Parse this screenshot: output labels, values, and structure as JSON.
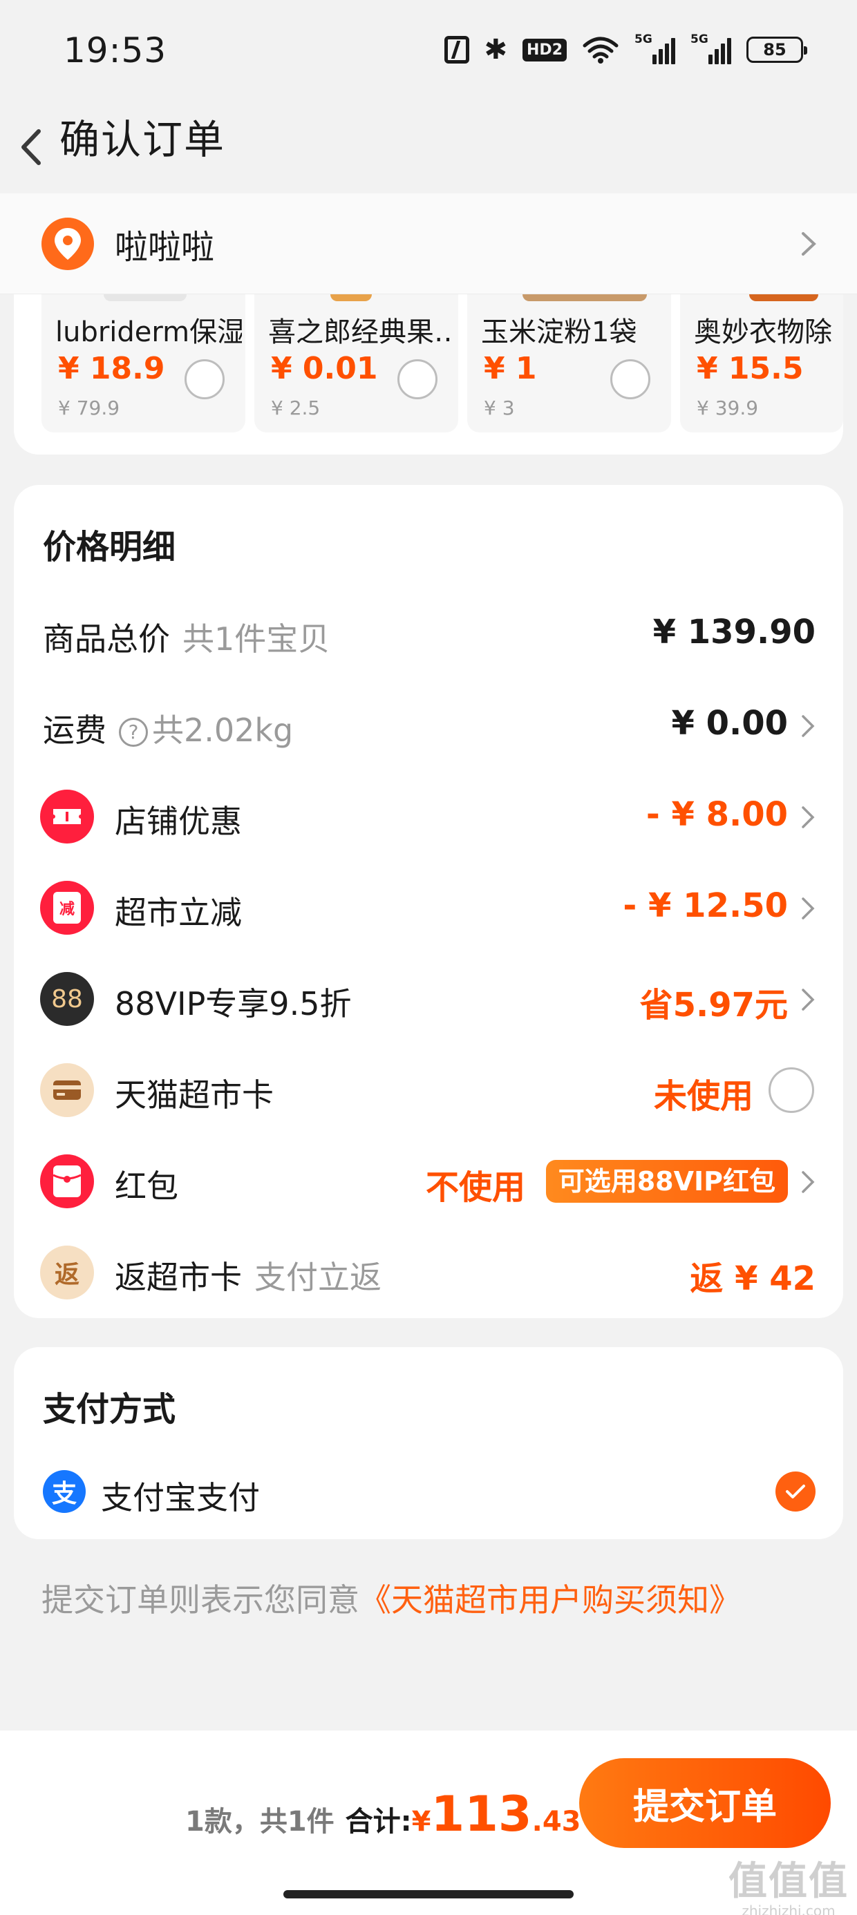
{
  "status_bar": {
    "time": "19:53",
    "hd_label": "HD2",
    "sig1_label": "5G",
    "sig2_label": "5G",
    "battery": "85"
  },
  "nav": {
    "title": "确认订单"
  },
  "address": {
    "text": "啦啦啦"
  },
  "products": [
    {
      "name": "lubriderm保湿…",
      "price": "¥ 18.9",
      "original": "¥ 79.9"
    },
    {
      "name": "喜之郎经典果…",
      "price": "¥ 0.01",
      "original": "¥ 2.5"
    },
    {
      "name": "玉米淀粉1袋",
      "price": "¥ 1",
      "original": "¥ 3"
    },
    {
      "name": "奥妙衣物除",
      "price": "¥ 15.5",
      "original": "¥ 39.9"
    }
  ],
  "price_detail": {
    "title": "价格明细",
    "goods_total": {
      "label": "商品总价",
      "sub": "共1件宝贝",
      "value": "¥ 139.90"
    },
    "shipping": {
      "label": "运费",
      "sub": "共2.02kg",
      "value": "¥ 0.00"
    },
    "store_discount": {
      "label": "店铺优惠",
      "value": "- ¥ 8.00"
    },
    "market_discount": {
      "label": "超市立减",
      "icon_text": "减",
      "value": "- ¥ 12.50"
    },
    "vip": {
      "label": "88VIP专享9.5折",
      "icon_text": "88",
      "value": "省5.97元"
    },
    "card": {
      "label": "天猫超市卡",
      "value": "未使用"
    },
    "red_packet": {
      "label": "红包",
      "value": "不使用",
      "pill": "可选用88VIP红包"
    },
    "cashback": {
      "label": "返超市卡",
      "icon_text": "返",
      "sub": "支付立返",
      "value": "返 ¥ 42"
    }
  },
  "payment": {
    "title": "支付方式",
    "method": "支付宝支付",
    "icon_text": "支"
  },
  "agreement": {
    "text": "提交订单则表示您同意",
    "link": "《天猫超市用户购买须知》"
  },
  "bottom": {
    "count": "1款，共1件",
    "total_label": "合计:",
    "currency": "¥",
    "total_int": "113",
    "total_dec": ".43",
    "submit": "提交订单"
  },
  "watermark": {
    "big": "值值值",
    "small": "zhizhizhi.com"
  },
  "colors": {
    "accent": "#ff5000",
    "alipay": "#1677ff",
    "background": "#f2f2f2"
  }
}
